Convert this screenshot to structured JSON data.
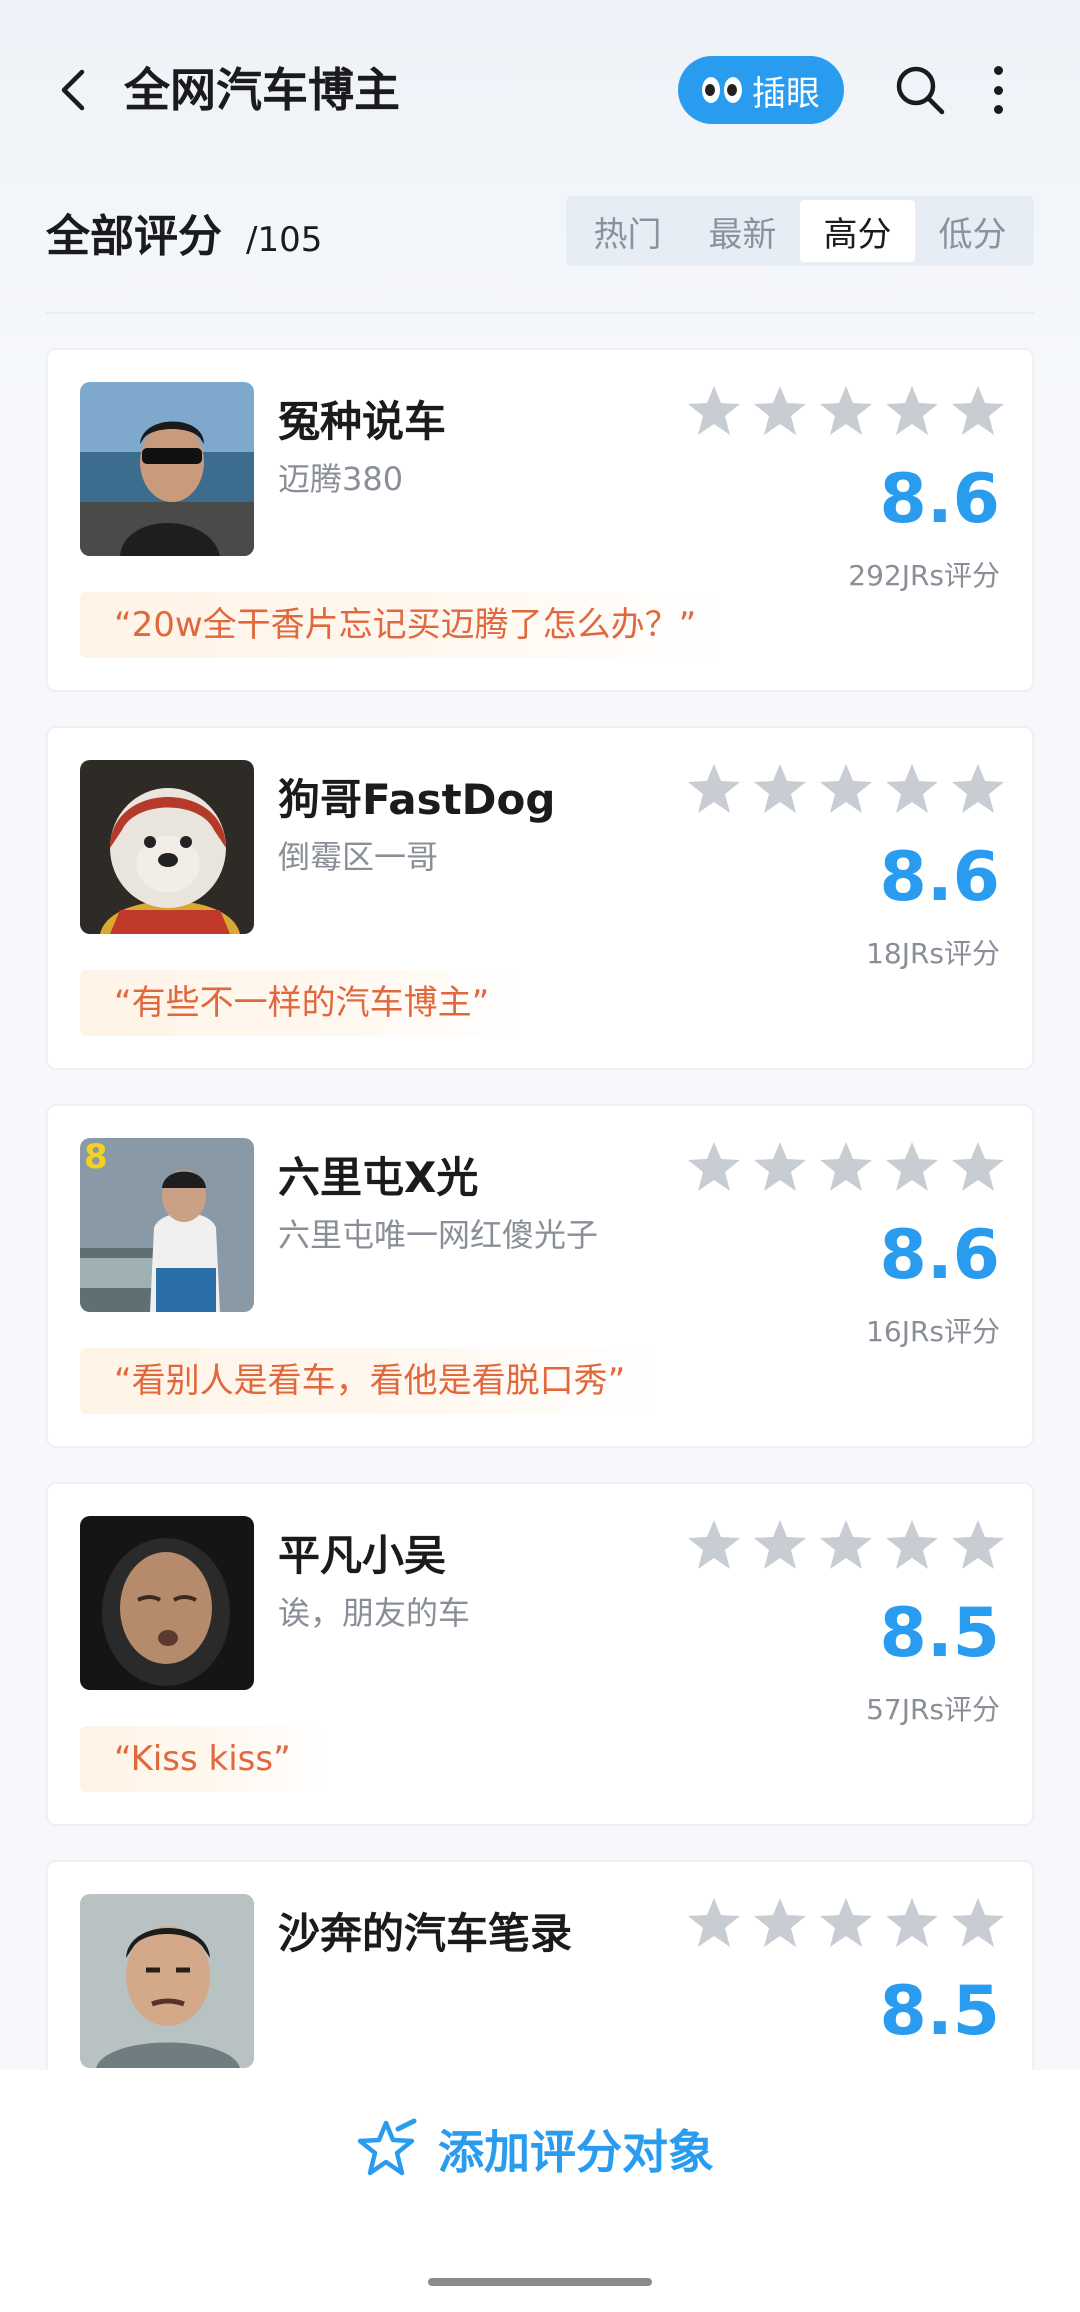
{
  "header": {
    "title": "全网汽车博主",
    "peek_label": "插眼"
  },
  "section": {
    "title": "全部评分",
    "count": "/105",
    "sort_tabs": [
      "热门",
      "最新",
      "高分",
      "低分"
    ],
    "active_sort": "高分"
  },
  "items": [
    {
      "name": "冤种说车",
      "subtitle": "迈腾380",
      "score": "8.6",
      "raters": "292JRs评分",
      "quote": "“20w全干香片忘记买迈腾了怎么办？”",
      "avatar_bg": "#3a6b8f"
    },
    {
      "name": "狗哥FastDog",
      "subtitle": "倒霉区一哥",
      "score": "8.6",
      "raters": "18JRs评分",
      "quote": "“有些不一样的汽车博主”",
      "avatar_bg": "#2b2b2b"
    },
    {
      "name": "六里屯X光",
      "subtitle": "六里屯唯一网红傻光子",
      "score": "8.6",
      "raters": "16JRs评分",
      "quote": "“看别人是看车，看他是看脱口秀”",
      "avatar_bg": "#7c8a98"
    },
    {
      "name": "平凡小吴",
      "subtitle": "诶，朋友的车",
      "score": "8.5",
      "raters": "57JRs评分",
      "quote": "“Kiss kiss”",
      "avatar_bg": "#1a1a1a"
    },
    {
      "name": "沙奔的汽车笔录",
      "subtitle": "",
      "score": "8.5",
      "raters": "",
      "quote": "",
      "avatar_bg": "#9aa6a8"
    }
  ],
  "bottom": {
    "add_label": "添加评分对象"
  },
  "colors": {
    "accent": "#2a9cf0",
    "quote_text": "#e0683c",
    "star_empty": "#c8ccd3"
  }
}
